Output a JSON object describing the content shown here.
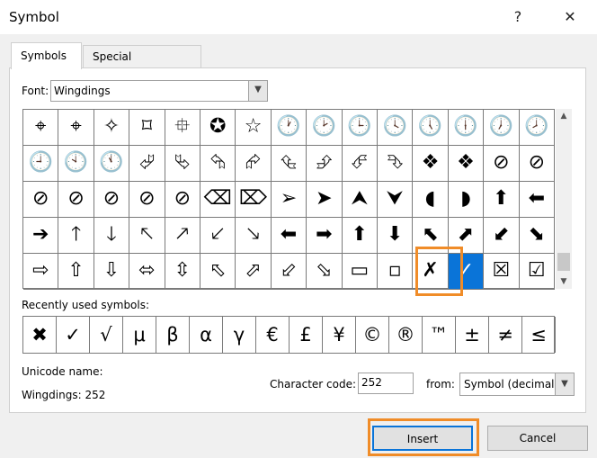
{
  "window": {
    "title": "Symbol",
    "help": "?",
    "close": "✕"
  },
  "tabs": [
    {
      "label": "Symbols",
      "active": true
    },
    {
      "label": "Special Characters",
      "active": false
    }
  ],
  "font": {
    "label": "Font:",
    "value": "Wingdings"
  },
  "symbols": [
    [
      "⌖",
      "⌖",
      "✧",
      "⌑",
      "⯐",
      "✪",
      "☆",
      "🕐",
      "🕑",
      "🕒",
      "🕓",
      "🕔",
      "🕕",
      "🕖",
      "🕗"
    ],
    [
      "🕘",
      "🕙",
      "🕚",
      "⮰",
      "⮱",
      "⮲",
      "⮳",
      "⮴",
      "⮵",
      "⮶",
      "⮷",
      "❖",
      "❖",
      "⊘",
      "⊘"
    ],
    [
      "⊘",
      "⊘",
      "⊘",
      "⊘",
      "⊘",
      "⌫",
      "⌦",
      "➢",
      "➤",
      "⮝",
      "⮟",
      "◖",
      "◗",
      "⬆",
      "⬅"
    ],
    [
      "➔",
      "🡑",
      "🡓",
      "🡔",
      "🡕",
      "🡗",
      "🡖",
      "⬅",
      "➡",
      "⬆",
      "⬇",
      "⬉",
      "⬈",
      "⬋",
      "⬊"
    ],
    [
      "⇨",
      "⇧",
      "⇩",
      "⬄",
      "⇳",
      "⬁",
      "⬀",
      "⬃",
      "⬂",
      "▭",
      "▫",
      "✗",
      "✓",
      "☒",
      "☑"
    ]
  ],
  "selected": {
    "row": 4,
    "col": 12
  },
  "recent": {
    "label": "Recently used symbols:",
    "items": [
      "✖",
      "✓",
      "√",
      "μ",
      "β",
      "α",
      "γ",
      "€",
      "£",
      "¥",
      "©",
      "®",
      "™",
      "±",
      "≠",
      "≤"
    ]
  },
  "unicode": {
    "label": "Unicode name:",
    "value": "Wingdings: 252"
  },
  "code": {
    "label": "Character code:",
    "value": "252"
  },
  "from": {
    "label": "from:",
    "value": "Symbol (decimal)"
  },
  "buttons": {
    "insert": "Insert",
    "cancel": "Cancel"
  },
  "colors": {
    "accent": "#0a74d8",
    "highlight": "#f08c28"
  }
}
